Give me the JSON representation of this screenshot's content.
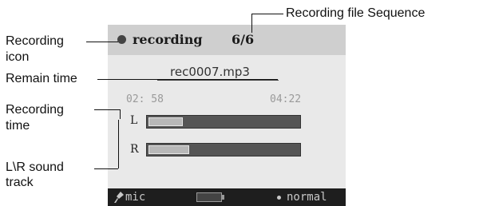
{
  "annotations": {
    "recording_file_sequence": "Recording file Sequence",
    "recording_icon_line1": "Recording",
    "recording_icon_line2": "icon",
    "remain_time": "Remain time",
    "recording_time_line1": "Recording",
    "recording_time_line2": "time",
    "lr_track_line1": "L\\R sound",
    "lr_track_line2": "track"
  },
  "header": {
    "status_label": "recording",
    "sequence": "6/6"
  },
  "file": {
    "name": "rec0007.mp3"
  },
  "times": {
    "recording": "02: 58",
    "remain": "04:22"
  },
  "tracks": [
    {
      "label": "L",
      "level": 0.23
    },
    {
      "label": "R",
      "level": 0.27
    }
  ],
  "footer": {
    "source": "mic",
    "mode": "normal"
  },
  "colors": {
    "header_bg": "#cfcfcf",
    "screen_bg": "#e9e9e9",
    "footer_bg": "#1e1e1e",
    "track_bg": "#555555",
    "track_fill": "#b8b8b8"
  },
  "icons": {
    "recording": "record-dot-icon",
    "source": "mic-icon",
    "battery": "battery-icon",
    "mode": "dot-icon"
  }
}
